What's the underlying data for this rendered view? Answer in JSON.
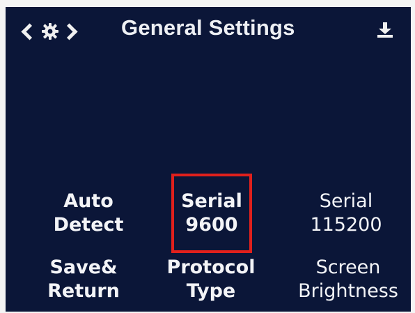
{
  "header": {
    "title": "General Settings"
  },
  "buttons": {
    "auto_detect": {
      "line1": "Auto",
      "line2": "Detect"
    },
    "serial_9600": {
      "line1": "Serial",
      "line2": "9600"
    },
    "serial_115200": {
      "line1": "Serial",
      "line2": "115200"
    },
    "save_return": {
      "line1": "Save&",
      "line2": "Return"
    },
    "protocol_type": {
      "line1": "Protocol",
      "line2": "Type"
    },
    "screen_brightness": {
      "line1": "Screen",
      "line2": "Brightness"
    }
  },
  "selection": {
    "selected_button": "serial_9600",
    "highlight_color": "#e0201c"
  },
  "colors": {
    "screen_background": "#0b1638",
    "text": "#f3f4f7"
  },
  "icons": {
    "nav": "settings-nav-icon",
    "gear": "gear-icon",
    "download": "download-icon"
  }
}
